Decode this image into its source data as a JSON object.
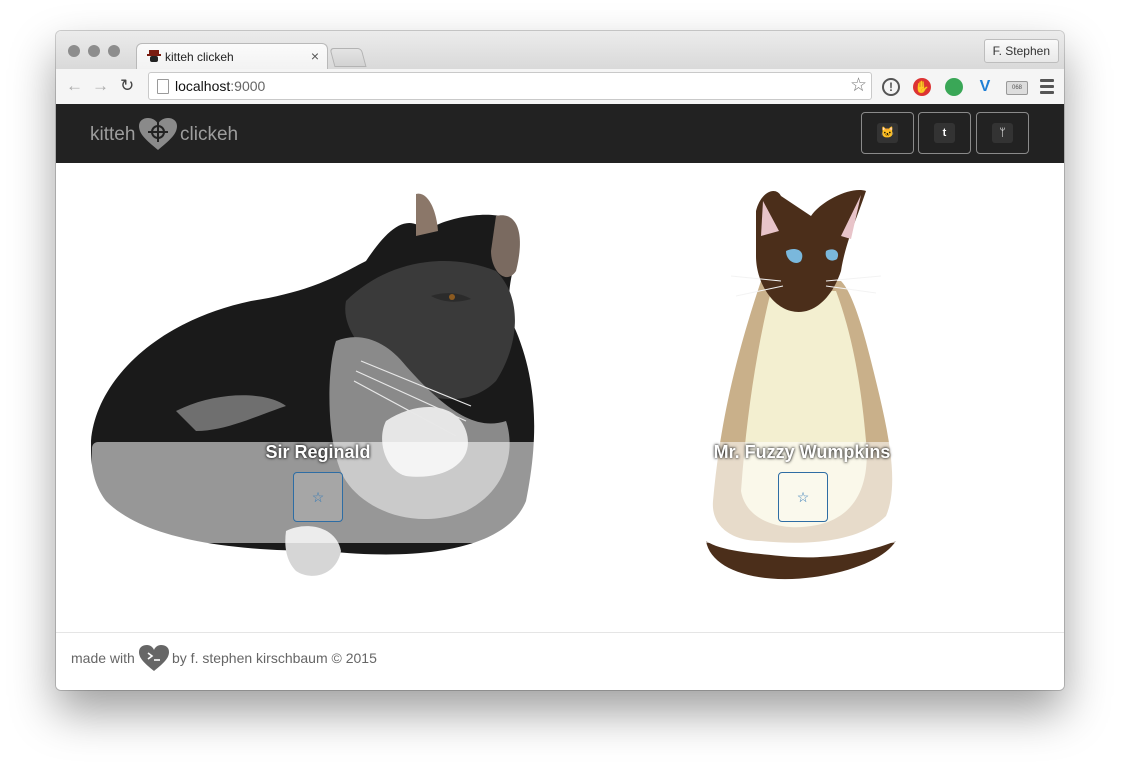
{
  "browser": {
    "tab_title": "kitteh clickeh",
    "tab_close": "×",
    "profile_name": "F. Stephen",
    "url_host": "localhost",
    "url_port": ":9000",
    "nav_icons": [
      "back-arrow-icon",
      "forward-arrow-icon",
      "reload-icon"
    ],
    "extension_icons": [
      "info-icon",
      "hand-stop-icon",
      "green-leaf-icon",
      "v-logo-icon",
      "json-icon"
    ]
  },
  "navbar": {
    "brand_left": "kitteh",
    "brand_right": "clickeh",
    "buttons": [
      {
        "icon": "github-icon",
        "glyph": "🐱"
      },
      {
        "icon": "twitter-icon",
        "glyph": "t"
      },
      {
        "icon": "fork-icon",
        "glyph": "ᛘ"
      }
    ]
  },
  "cats": [
    {
      "name": "Sir Reginald",
      "favorite_icon": "☆",
      "colors": {
        "fur_dark": "#1a1a1a",
        "fur_mid": "#3c3c3c",
        "fur_light": "#a0a0a0"
      }
    },
    {
      "name": "Mr. Fuzzy Wumpkins",
      "favorite_icon": "☆",
      "colors": {
        "fur_dark": "#4b2e1a",
        "fur_mid": "#c9b08a",
        "fur_light": "#f3efd0"
      }
    }
  ],
  "footer": {
    "prefix": "made with",
    "suffix": "by f. stephen kirschbaum © 2015"
  },
  "colors": {
    "navbar_bg": "#222222",
    "brand_text": "#9d9d9d",
    "button_accent": "#337ab7"
  }
}
